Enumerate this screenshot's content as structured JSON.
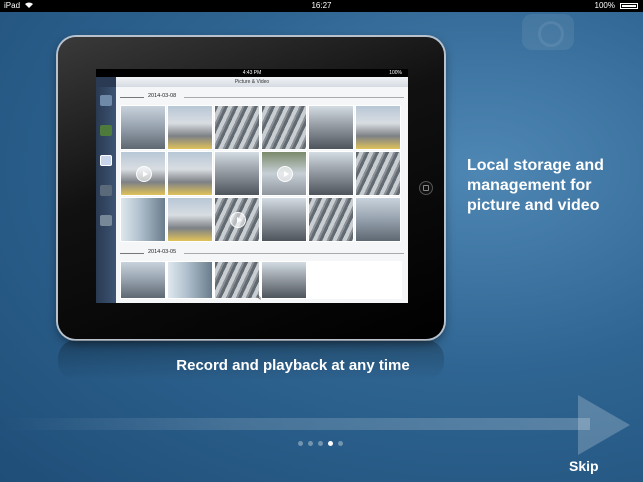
{
  "status_bar": {
    "carrier": "iPad",
    "wifi_icon": "wifi-icon",
    "time": "16:27",
    "battery": "100%"
  },
  "tablet_screen": {
    "status_time": "4:43 PM",
    "status_battery": "100%",
    "nav_title": "Picture & Video",
    "sections": [
      {
        "date": "2014-03-08"
      },
      {
        "date": "2014-03-05"
      }
    ]
  },
  "caption_right": "Local storage and management for picture and video",
  "caption_bottom": "Record and playback at any time",
  "pager": {
    "count": 5,
    "active_index": 3
  },
  "skip_label": "Skip"
}
